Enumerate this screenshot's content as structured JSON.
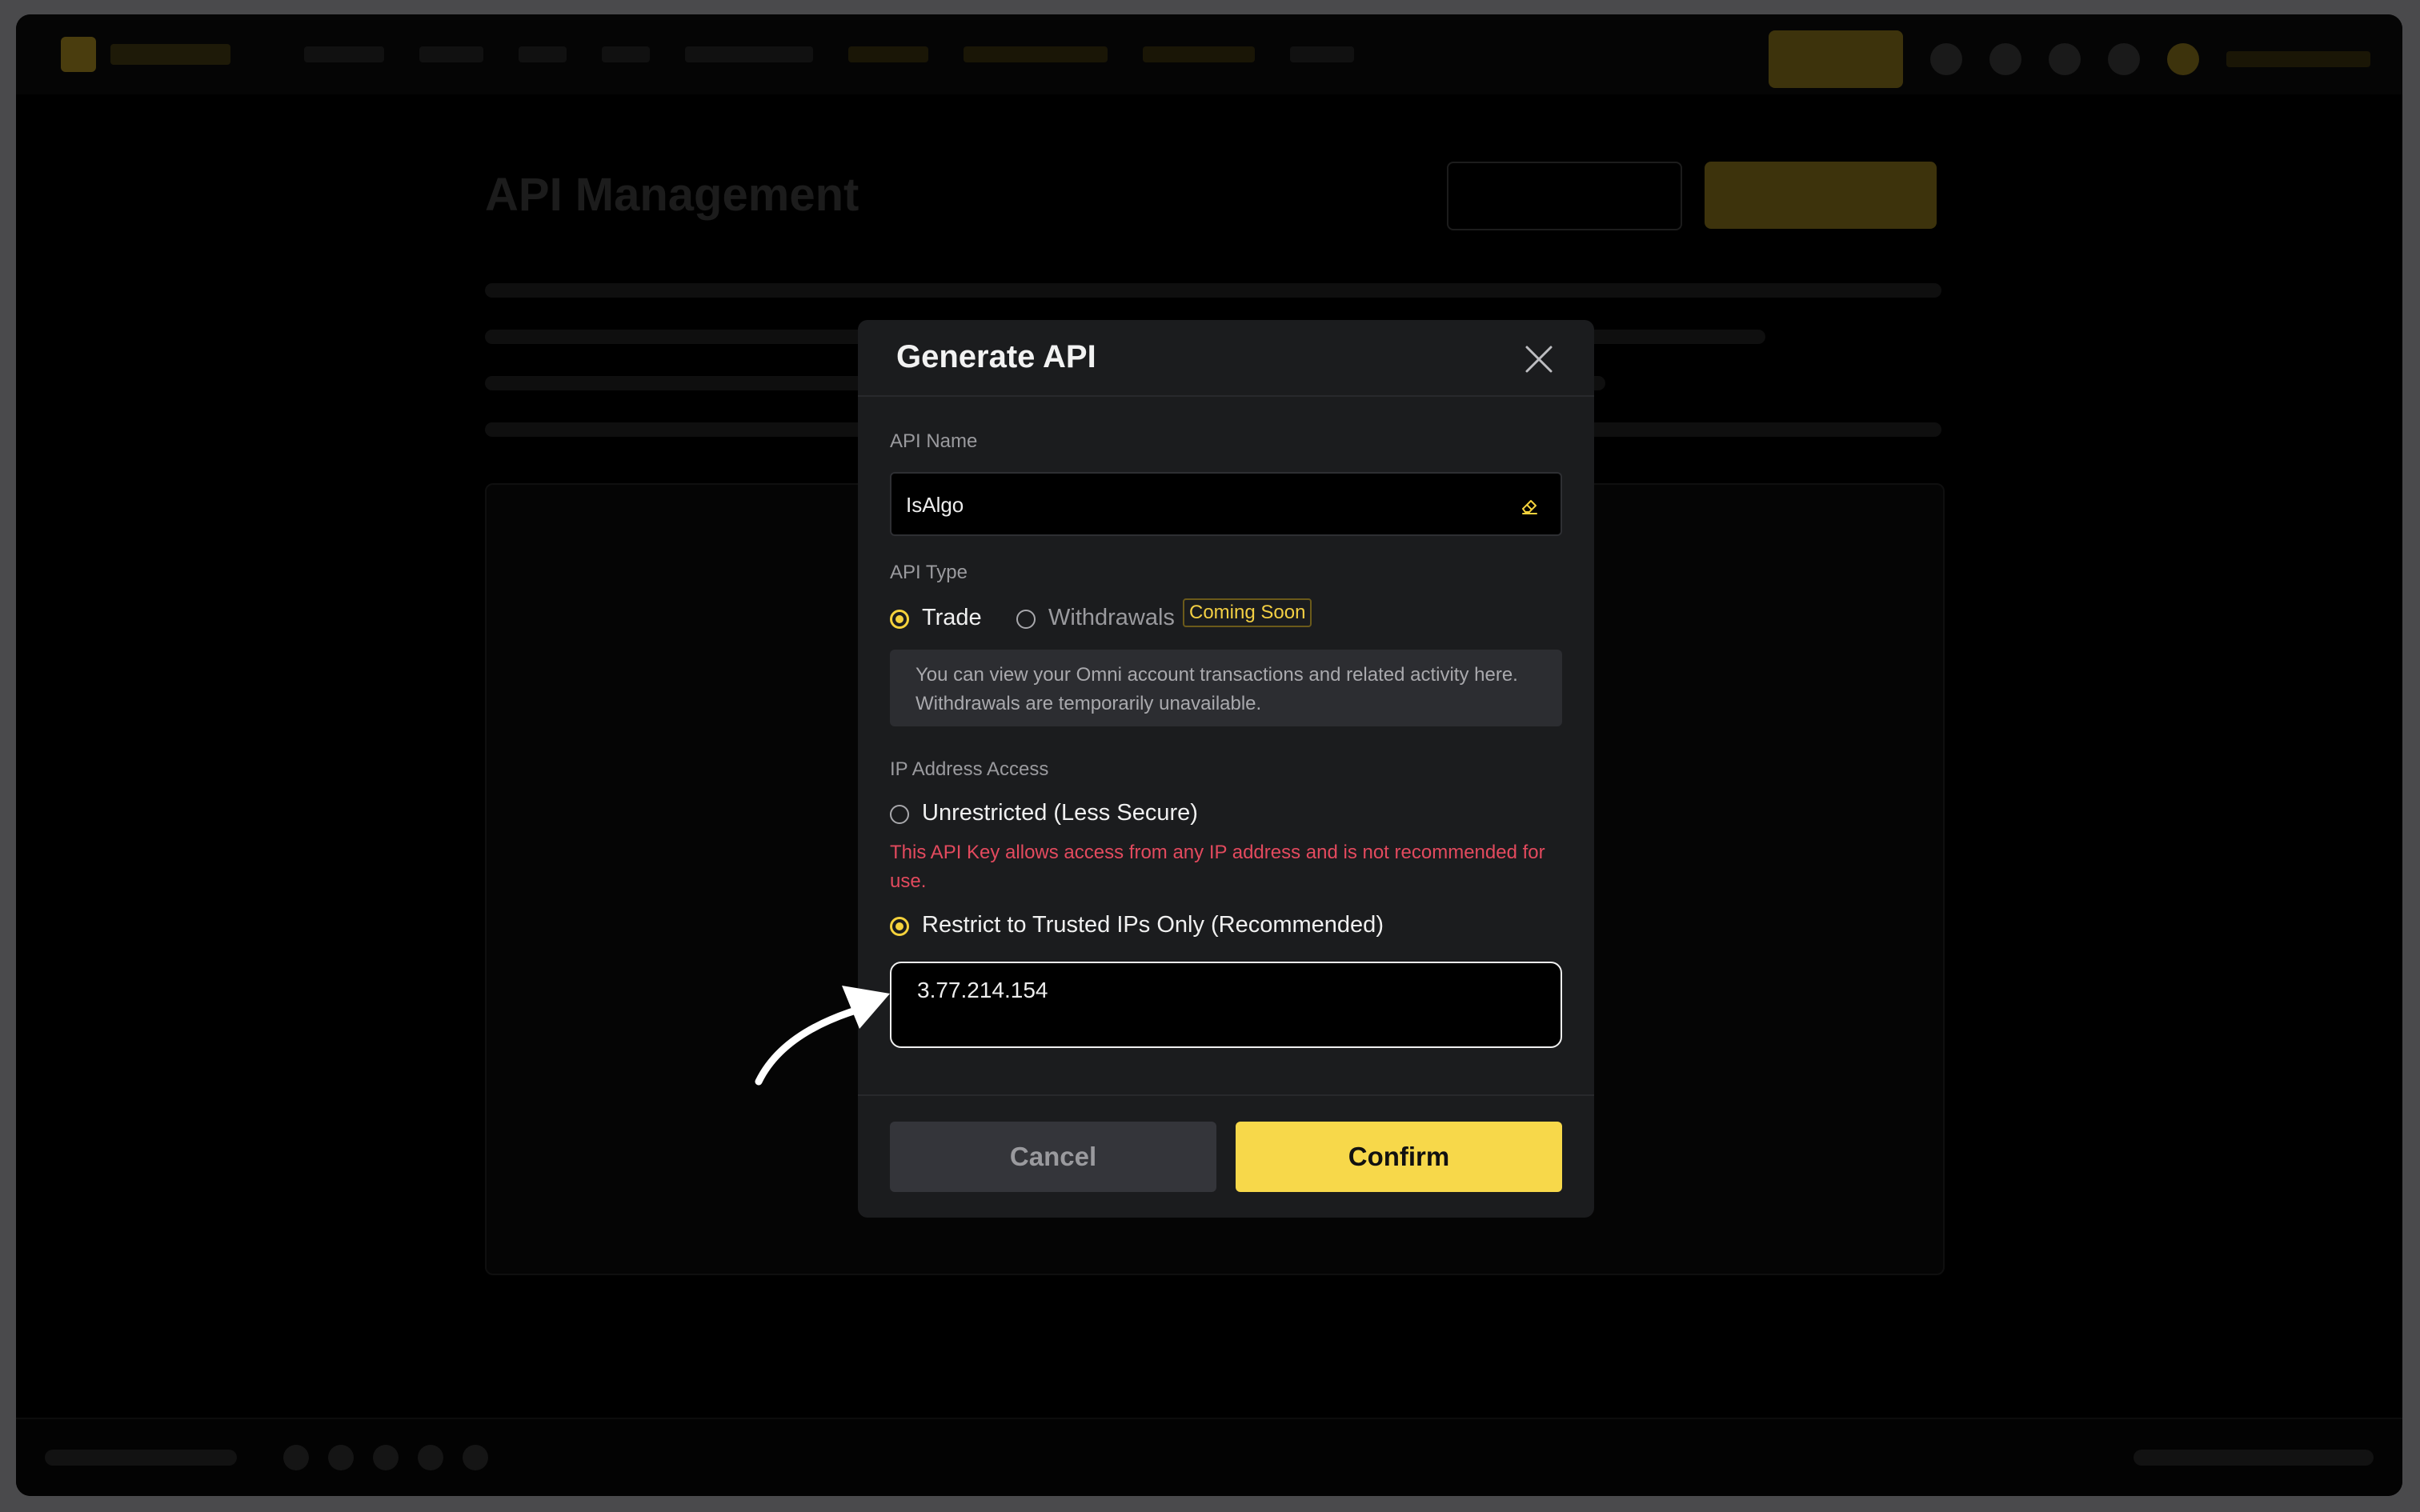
{
  "background_page": {
    "title": "API Management"
  },
  "modal": {
    "title": "Generate API",
    "api_name": {
      "label": "API Name",
      "value": "IsAlgo"
    },
    "api_type": {
      "label": "API Type",
      "options": [
        {
          "label": "Trade",
          "selected": true
        },
        {
          "label": "Withdrawals",
          "selected": false
        }
      ],
      "badge": "Coming Soon",
      "info_line1": "You can view your Omni account transactions and related activity here.",
      "info_line2": "Withdrawals are temporarily unavailable."
    },
    "ip_access": {
      "label": "IP Address Access",
      "unrestricted_label": "Unrestricted (Less Secure)",
      "unrestricted_selected": false,
      "warning": "This API Key allows access from any IP address and is not recommended for use.",
      "restricted_label": "Restrict to Trusted IPs Only (Recommended)",
      "restricted_selected": true,
      "ip_value": "3.77.214.154"
    },
    "buttons": {
      "cancel": "Cancel",
      "confirm": "Confirm"
    }
  },
  "colors": {
    "accent": "#f7d84a",
    "warning": "#e34a5e",
    "modal_bg": "#1b1c1e"
  },
  "icons": [
    "close-icon",
    "eraser-icon",
    "arrow-annotation-icon"
  ]
}
